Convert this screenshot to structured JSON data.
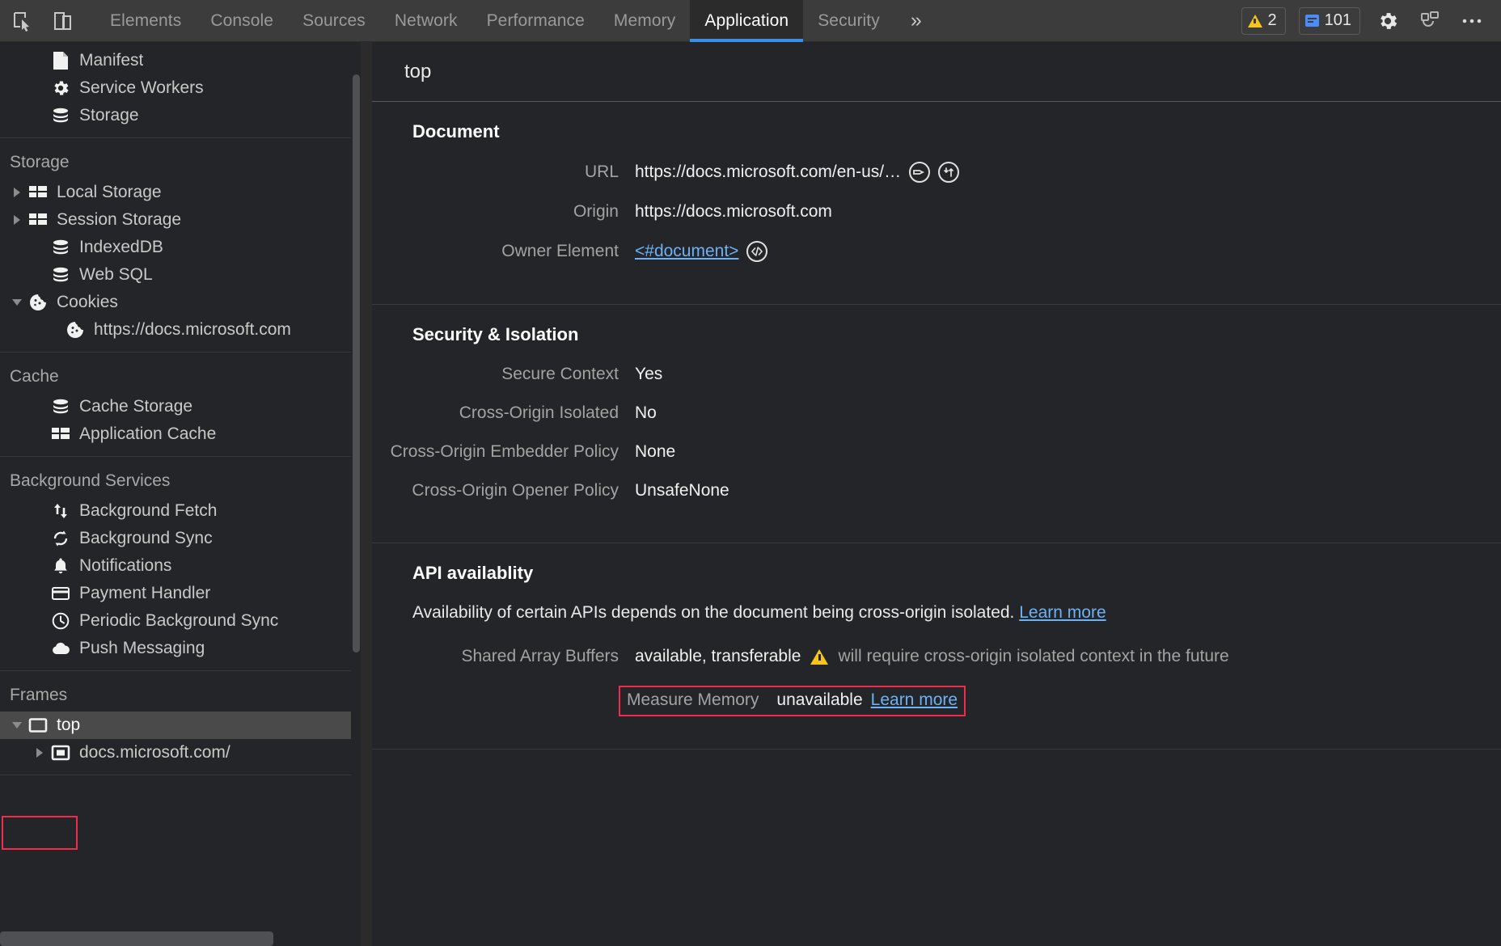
{
  "toolbar": {
    "inspect_icon": "inspect-element-icon",
    "device_icon": "device-toolbar-icon",
    "tabs": [
      {
        "label": "Elements",
        "selected": false
      },
      {
        "label": "Console",
        "selected": false
      },
      {
        "label": "Sources",
        "selected": false
      },
      {
        "label": "Network",
        "selected": false
      },
      {
        "label": "Performance",
        "selected": false
      },
      {
        "label": "Memory",
        "selected": false
      },
      {
        "label": "Application",
        "selected": true
      },
      {
        "label": "Security",
        "selected": false
      }
    ],
    "more_tabs_label": "»",
    "warning_count": "2",
    "message_count": "101",
    "settings_icon": "gear-icon",
    "dock_icon": "dock-position-icon",
    "more_icon": "more-options-icon",
    "accent_color": "#3b8eea",
    "warning_color": "#f5c518",
    "info_color": "#4a8df8"
  },
  "sidebar": {
    "groups": [
      {
        "title": "",
        "items": [
          {
            "label": "Manifest",
            "icon": "manifest-document-icon",
            "twisty": "none",
            "indent": 1
          },
          {
            "label": "Service Workers",
            "icon": "gear-icon",
            "twisty": "none",
            "indent": 1
          },
          {
            "label": "Storage",
            "icon": "database-icon",
            "twisty": "none",
            "indent": 1
          }
        ]
      },
      {
        "title": "Storage",
        "items": [
          {
            "label": "Local Storage",
            "icon": "table-grid-icon",
            "twisty": "collapsed",
            "indent": 1
          },
          {
            "label": "Session Storage",
            "icon": "table-grid-icon",
            "twisty": "collapsed",
            "indent": 1
          },
          {
            "label": "IndexedDB",
            "icon": "database-icon",
            "twisty": "none",
            "indent": 1
          },
          {
            "label": "Web SQL",
            "icon": "database-icon",
            "twisty": "none",
            "indent": 1
          },
          {
            "label": "Cookies",
            "icon": "cookie-icon",
            "twisty": "expanded",
            "indent": 1
          },
          {
            "label": "https://docs.microsoft.com",
            "icon": "cookie-icon",
            "twisty": "none",
            "indent": 2
          }
        ]
      },
      {
        "title": "Cache",
        "items": [
          {
            "label": "Cache Storage",
            "icon": "database-icon",
            "twisty": "none",
            "indent": 1
          },
          {
            "label": "Application Cache",
            "icon": "table-grid-icon",
            "twisty": "none",
            "indent": 1
          }
        ]
      },
      {
        "title": "Background Services",
        "items": [
          {
            "label": "Background Fetch",
            "icon": "up-down-arrows-icon",
            "twisty": "none",
            "indent": 1
          },
          {
            "label": "Background Sync",
            "icon": "sync-refresh-icon",
            "twisty": "none",
            "indent": 1
          },
          {
            "label": "Notifications",
            "icon": "bell-icon",
            "twisty": "none",
            "indent": 1
          },
          {
            "label": "Payment Handler",
            "icon": "credit-card-icon",
            "twisty": "none",
            "indent": 1
          },
          {
            "label": "Periodic Background Sync",
            "icon": "clock-icon",
            "twisty": "none",
            "indent": 1
          },
          {
            "label": "Push Messaging",
            "icon": "cloud-icon",
            "twisty": "none",
            "indent": 1
          }
        ]
      },
      {
        "title": "Frames",
        "highlighted": true,
        "items": [
          {
            "label": "top",
            "icon": "frame-icon",
            "twisty": "expanded",
            "indent": 1,
            "selected": true
          },
          {
            "label": "docs.microsoft.com/",
            "icon": "nested-frame-icon",
            "twisty": "collapsed",
            "indent": 2
          }
        ]
      }
    ]
  },
  "main": {
    "header_title": "top",
    "sections": [
      {
        "title": "Document",
        "rows": [
          {
            "key": "URL",
            "value": "https://docs.microsoft.com/en-us/…",
            "icons": [
              "show-request-icon",
              "open-in-new-tab-icon"
            ]
          },
          {
            "key": "Origin",
            "value": "https://docs.microsoft.com",
            "icons": []
          },
          {
            "key": "Owner Element",
            "value": "<#document>",
            "link": true,
            "icons": [
              "reveal-in-elements-icon"
            ]
          }
        ]
      },
      {
        "title": "Security & Isolation",
        "rows": [
          {
            "key": "Secure Context",
            "value": "Yes",
            "icons": []
          },
          {
            "key": "Cross-Origin Isolated",
            "value": "No",
            "icons": []
          },
          {
            "key": "Cross-Origin Embedder Policy",
            "value": "None",
            "icons": []
          },
          {
            "key": "Cross-Origin Opener Policy",
            "value": "UnsafeNone",
            "icons": []
          }
        ]
      }
    ],
    "api_section": {
      "title": "API availablity",
      "description": "Availability of certain APIs depends on the document being cross-origin isolated.",
      "description_link": "Learn more",
      "shared_array_buffers": {
        "key": "Shared Array Buffers",
        "value": "available, transferable",
        "warning_icon": "warning-triangle-icon",
        "warning_text": "will require cross-origin isolated context in the future"
      },
      "measure_memory": {
        "key": "Measure Memory",
        "value": "unavailable",
        "link": "Learn more",
        "highlighted": true
      }
    }
  },
  "annotations": {
    "highlight_color": "#f02b4b"
  }
}
